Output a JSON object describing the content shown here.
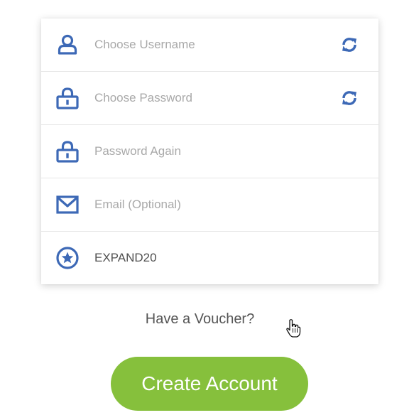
{
  "form": {
    "fields": [
      {
        "id": "username",
        "placeholder": "Choose Username",
        "value": "",
        "icon": "user-icon",
        "has_refresh": true
      },
      {
        "id": "password",
        "placeholder": "Choose Password",
        "value": "",
        "icon": "lock-icon",
        "has_refresh": true
      },
      {
        "id": "password_again",
        "placeholder": "Password Again",
        "value": "",
        "icon": "lock-icon",
        "has_refresh": false
      },
      {
        "id": "email",
        "placeholder": "Email (Optional)",
        "value": "",
        "icon": "envelope-icon",
        "has_refresh": false
      },
      {
        "id": "voucher",
        "placeholder": "",
        "value": "EXPAND20",
        "icon": "star-badge-icon",
        "has_refresh": false
      }
    ]
  },
  "voucher_link": {
    "label": "Have a Voucher?"
  },
  "create_button": {
    "label": "Create Account"
  },
  "colors": {
    "icon_blue": "#3d69b6",
    "button_green": "#86c03c",
    "text_gray": "#555555",
    "placeholder_gray": "#a9a9a9"
  }
}
